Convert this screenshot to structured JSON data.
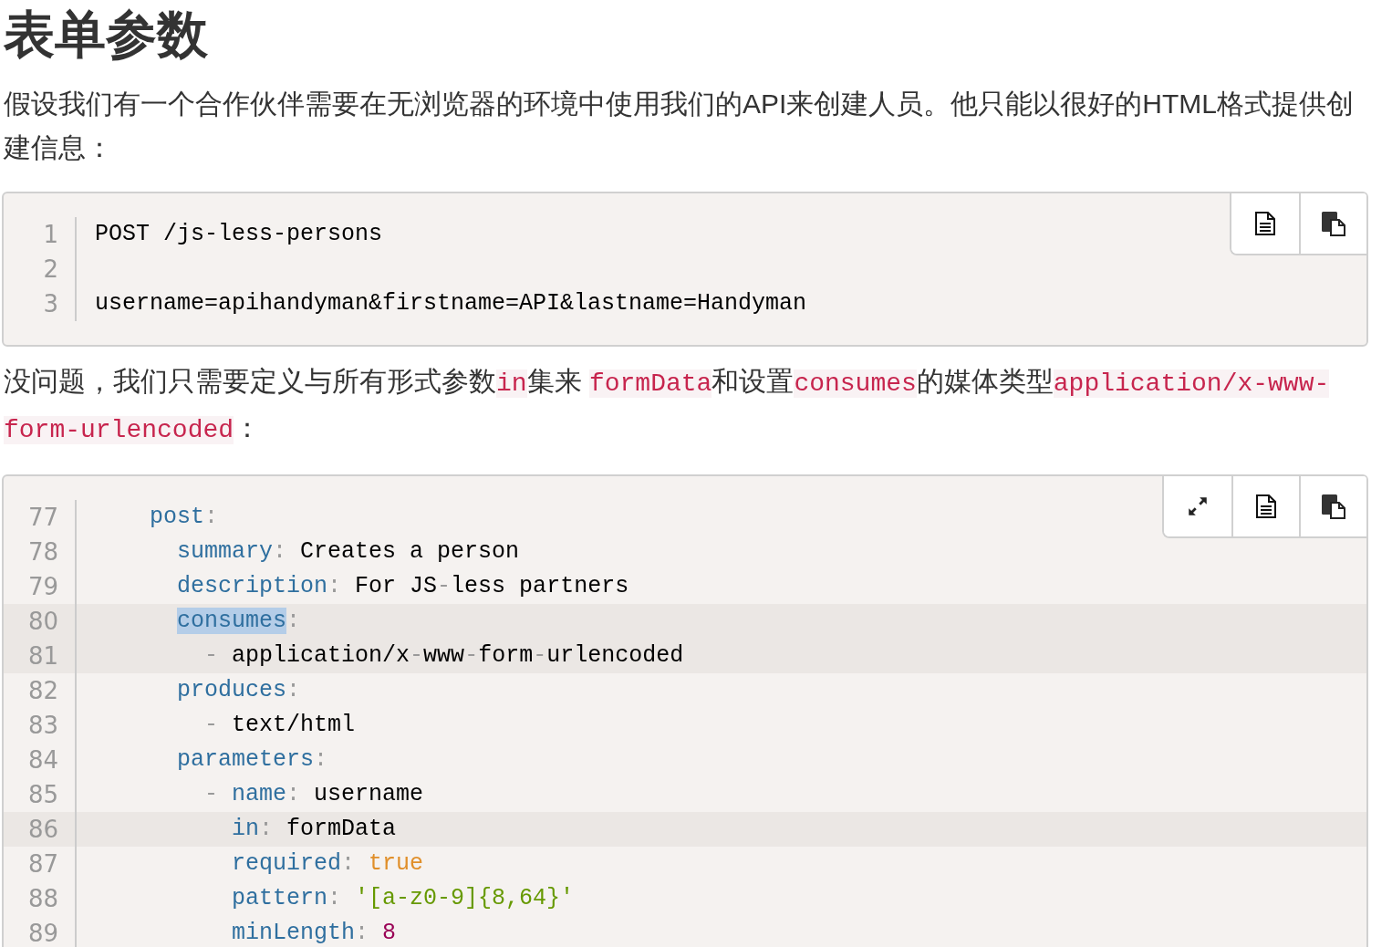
{
  "heading": "表单参数",
  "intro": "假设我们有一个合作伙伴需要在无浏览器的环境中使用我们的API来创建人员。他只能以很好的HTML格式提供创建信息：",
  "code_blocks": [
    {
      "buttons": [
        {
          "kind": "copy-text"
        },
        {
          "kind": "copy"
        }
      ],
      "lines": [
        {
          "number": "1",
          "highlighted": false,
          "tokens": [
            {
              "kind": "text",
              "text": "POST /js-less-persons"
            }
          ]
        },
        {
          "number": "2",
          "highlighted": false
        },
        {
          "number": "3",
          "highlighted": false,
          "tokens": [
            {
              "kind": "text",
              "text": "username=apihandyman&firstname=API&lastname=Handyman"
            }
          ]
        }
      ]
    }
  ],
  "explanation": [
    {
      "kind": "text",
      "text": "没问题，我们只需要定义与所有形式参数"
    },
    {
      "kind": "code",
      "text": "in"
    },
    {
      "kind": "text",
      "text": "集来 "
    },
    {
      "kind": "code",
      "text": "formData"
    },
    {
      "kind": "text",
      "text": "和设置"
    },
    {
      "kind": "code",
      "text": "consumes"
    },
    {
      "kind": "text",
      "text": "的媒体类型"
    },
    {
      "kind": "code",
      "text": "application/x-www-form-urlencoded"
    },
    {
      "kind": "text",
      "text": "："
    }
  ],
  "yaml_block": {
    "buttons": [
      {
        "kind": "expand"
      },
      {
        "kind": "copy-text"
      },
      {
        "kind": "copy"
      }
    ],
    "lines": [
      {
        "number": "77",
        "highlighted": false,
        "tokens": [
          {
            "kind": "key",
            "text": "    post"
          },
          {
            "kind": "punct",
            "text": ":"
          }
        ]
      },
      {
        "number": "78",
        "highlighted": false,
        "tokens": [
          {
            "kind": "key",
            "text": "      summary"
          },
          {
            "kind": "punct",
            "text": ":"
          },
          {
            "kind": "text",
            "text": " Creates a person"
          }
        ]
      },
      {
        "number": "79",
        "highlighted": false,
        "tokens": [
          {
            "kind": "key",
            "text": "      description"
          },
          {
            "kind": "punct",
            "text": ":"
          },
          {
            "kind": "text",
            "text": " For JS"
          },
          {
            "kind": "punct",
            "text": "-"
          },
          {
            "kind": "text",
            "text": "less partners"
          }
        ]
      },
      {
        "number": "80",
        "highlighted": true,
        "tokens": [
          {
            "kind": "selection",
            "text": "      consumes"
          },
          {
            "kind": "punct",
            "text": ":"
          }
        ]
      },
      {
        "number": "81",
        "highlighted": true,
        "tokens": [
          {
            "kind": "punct",
            "text": "        - "
          },
          {
            "kind": "text",
            "text": "application/x"
          },
          {
            "kind": "punct",
            "text": "-"
          },
          {
            "kind": "text",
            "text": "www"
          },
          {
            "kind": "punct",
            "text": "-"
          },
          {
            "kind": "text",
            "text": "form"
          },
          {
            "kind": "punct",
            "text": "-"
          },
          {
            "kind": "text",
            "text": "urlencoded"
          }
        ]
      },
      {
        "number": "82",
        "highlighted": false,
        "tokens": [
          {
            "kind": "key",
            "text": "      produces"
          },
          {
            "kind": "punct",
            "text": ":"
          }
        ]
      },
      {
        "number": "83",
        "highlighted": false,
        "tokens": [
          {
            "kind": "punct",
            "text": "        - "
          },
          {
            "kind": "text",
            "text": "text/html"
          }
        ]
      },
      {
        "number": "84",
        "highlighted": false,
        "tokens": [
          {
            "kind": "key",
            "text": "      parameters"
          },
          {
            "kind": "punct",
            "text": ":"
          }
        ]
      },
      {
        "number": "85",
        "highlighted": false,
        "tokens": [
          {
            "kind": "punct",
            "text": "        - "
          },
          {
            "kind": "key",
            "text": "name"
          },
          {
            "kind": "punct",
            "text": ":"
          },
          {
            "kind": "text",
            "text": " username"
          }
        ]
      },
      {
        "number": "86",
        "highlighted": true,
        "tokens": [
          {
            "kind": "key",
            "text": "          in"
          },
          {
            "kind": "punct",
            "text": ":"
          },
          {
            "kind": "text",
            "text": " formData"
          }
        ]
      },
      {
        "number": "87",
        "highlighted": false,
        "tokens": [
          {
            "kind": "key",
            "text": "          required"
          },
          {
            "kind": "punct",
            "text": ": "
          },
          {
            "kind": "bool",
            "text": "true"
          }
        ]
      },
      {
        "number": "88",
        "highlighted": false,
        "tokens": [
          {
            "kind": "key",
            "text": "          pattern"
          },
          {
            "kind": "punct",
            "text": ": "
          },
          {
            "kind": "string",
            "text": "'[a-z0-9]{8,64}'"
          }
        ]
      },
      {
        "number": "89",
        "highlighted": false,
        "tokens": [
          {
            "kind": "key",
            "text": "          minLength"
          },
          {
            "kind": "punct",
            "text": ": "
          },
          {
            "kind": "number",
            "text": "8"
          }
        ]
      }
    ]
  }
}
